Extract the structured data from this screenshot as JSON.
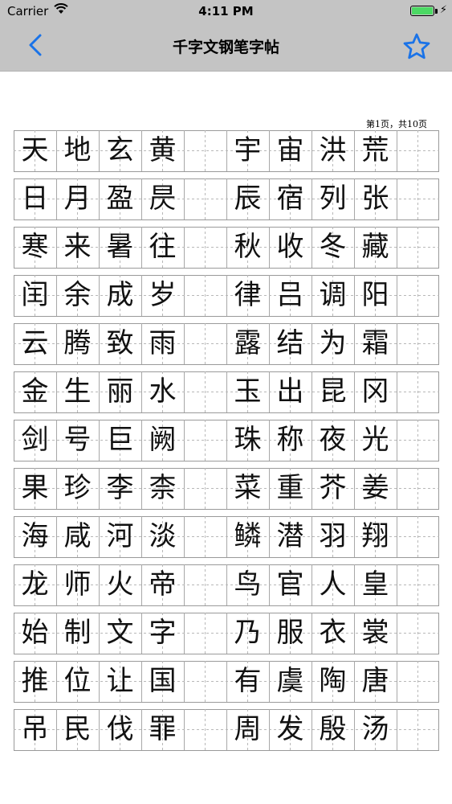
{
  "status_bar": {
    "carrier": "Carrier",
    "wifi_icon": "wifi-icon",
    "time": "4:11 PM",
    "battery_icon": "battery-icon",
    "charging_icon": "bolt-icon",
    "battery_level": 1.0,
    "battery_color": "#4cd964"
  },
  "nav": {
    "title": "千字文钢笔字帖",
    "back_icon": "chevron-left-icon",
    "favorite_icon": "star-icon",
    "accent_color": "#1a73e8"
  },
  "page_indicator": "第1页，共10页",
  "rows": [
    {
      "left": [
        "天",
        "地",
        "玄",
        "黄"
      ],
      "right": [
        "宇",
        "宙",
        "洪",
        "荒"
      ]
    },
    {
      "left": [
        "日",
        "月",
        "盈",
        "昃"
      ],
      "right": [
        "辰",
        "宿",
        "列",
        "张"
      ]
    },
    {
      "left": [
        "寒",
        "来",
        "暑",
        "往"
      ],
      "right": [
        "秋",
        "收",
        "冬",
        "藏"
      ]
    },
    {
      "left": [
        "闰",
        "余",
        "成",
        "岁"
      ],
      "right": [
        "律",
        "吕",
        "调",
        "阳"
      ]
    },
    {
      "left": [
        "云",
        "腾",
        "致",
        "雨"
      ],
      "right": [
        "露",
        "结",
        "为",
        "霜"
      ]
    },
    {
      "left": [
        "金",
        "生",
        "丽",
        "水"
      ],
      "right": [
        "玉",
        "出",
        "昆",
        "冈"
      ]
    },
    {
      "left": [
        "剑",
        "号",
        "巨",
        "阙"
      ],
      "right": [
        "珠",
        "称",
        "夜",
        "光"
      ]
    },
    {
      "left": [
        "果",
        "珍",
        "李",
        "柰"
      ],
      "right": [
        "菜",
        "重",
        "芥",
        "姜"
      ]
    },
    {
      "left": [
        "海",
        "咸",
        "河",
        "淡"
      ],
      "right": [
        "鳞",
        "潜",
        "羽",
        "翔"
      ]
    },
    {
      "left": [
        "龙",
        "师",
        "火",
        "帝"
      ],
      "right": [
        "鸟",
        "官",
        "人",
        "皇"
      ]
    },
    {
      "left": [
        "始",
        "制",
        "文",
        "字"
      ],
      "right": [
        "乃",
        "服",
        "衣",
        "裳"
      ]
    },
    {
      "left": [
        "推",
        "位",
        "让",
        "国"
      ],
      "right": [
        "有",
        "虞",
        "陶",
        "唐"
      ]
    },
    {
      "left": [
        "吊",
        "民",
        "伐",
        "罪"
      ],
      "right": [
        "周",
        "发",
        "殷",
        "汤"
      ]
    }
  ]
}
